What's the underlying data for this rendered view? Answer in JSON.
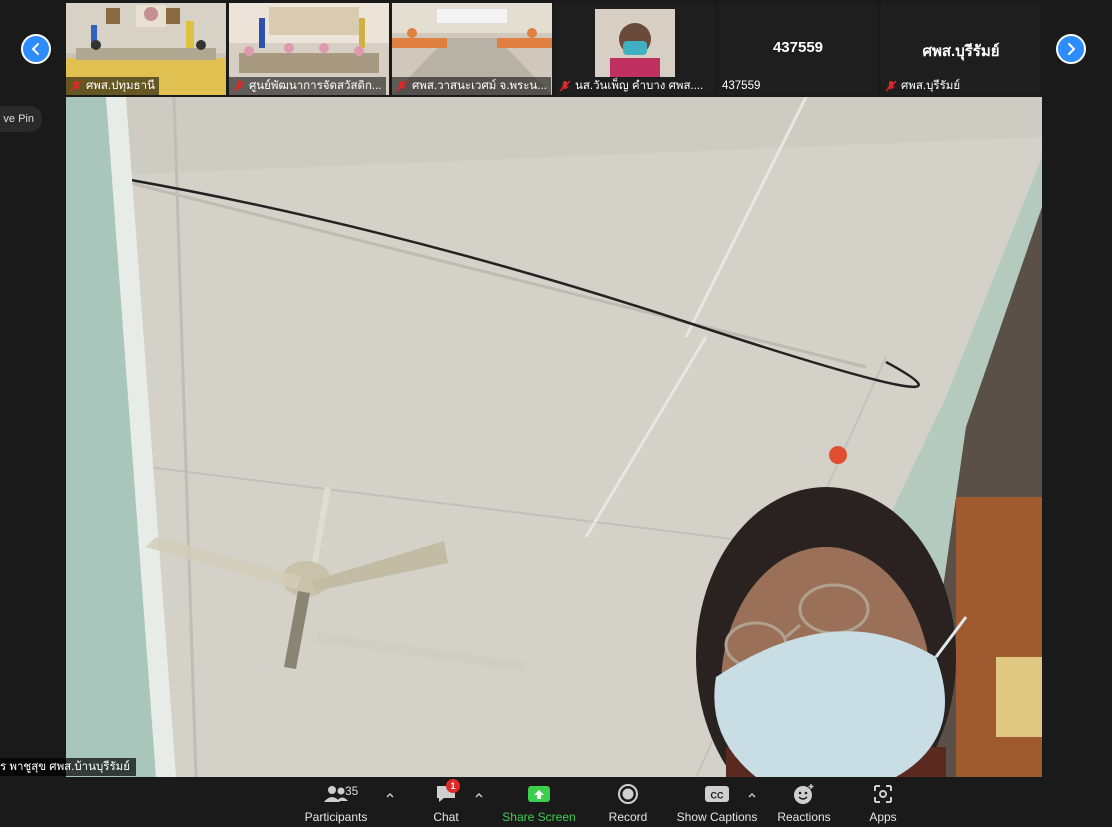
{
  "participants_strip": [
    {
      "name": "ศพส.ปทุมธานี"
    },
    {
      "name": "ศูนย์พัฒนาการจัดสวัสดิก..."
    },
    {
      "name": "ศพส.วาสนะเวศม์ จ.พระน..."
    },
    {
      "name": "นส.วันเพ็ญ คำบาง ศพส...."
    },
    {
      "name": "437559",
      "label": "437559"
    },
    {
      "name": "ศพส.บุรีรัมย์",
      "label": "ศพส.บุรีรัมย์"
    }
  ],
  "pin_tab": {
    "label": "ve Pin"
  },
  "active_speaker": {
    "name": "ร  พาชูสุข  ศพส.บ้านบุรีรัมย์"
  },
  "toolbar": {
    "participants": {
      "label": "Participants",
      "count": "35"
    },
    "chat": {
      "label": "Chat",
      "badge": "1"
    },
    "share": {
      "label": "Share Screen"
    },
    "record": {
      "label": "Record"
    },
    "captions": {
      "label": "Show Captions",
      "icon_text": "CC"
    },
    "reactions": {
      "label": "Reactions"
    },
    "apps": {
      "label": "Apps"
    }
  },
  "colors": {
    "accent": "#2d8cff",
    "share_green": "#3ccf4e",
    "mic_muted": "#e02828",
    "background": "#1a1a1a"
  }
}
